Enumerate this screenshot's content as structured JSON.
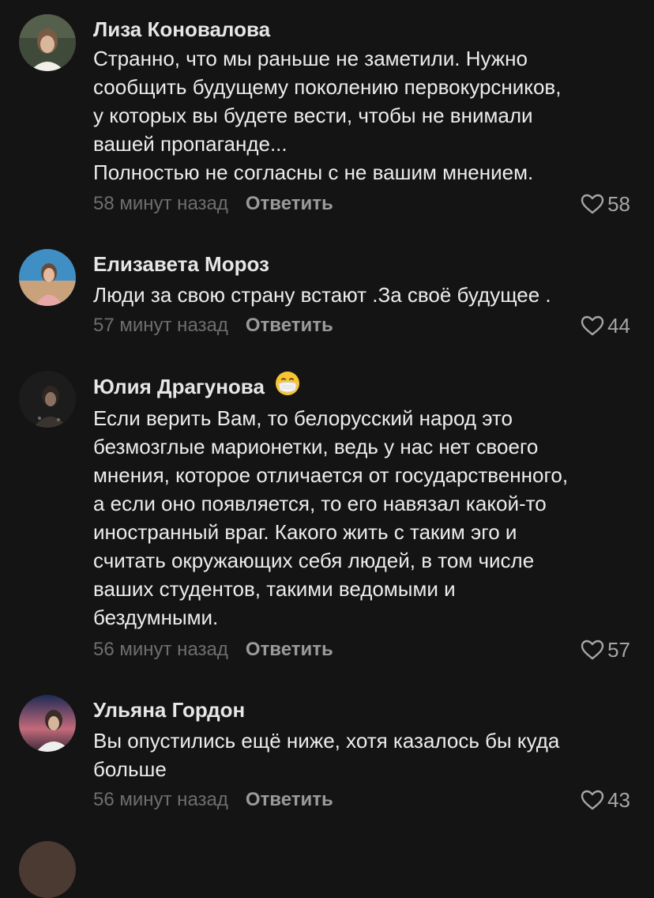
{
  "comments": [
    {
      "author": "Лиза Коновалова",
      "text": "Странно, что мы раньше не заметили. Нужно\nсообщить будущему поколению первокурсников,\nу которых вы будете вести, чтобы не внимали\nвашей пропаганде...\nПолностью не согласны с не вашим мнением.",
      "time": "58 минут назад",
      "reply_label": "Ответить",
      "likes": "58"
    },
    {
      "author": "Елизавета Мороз",
      "text": "Люди за свою страну встают .За своё будущее .",
      "time": "57 минут назад",
      "reply_label": "Ответить",
      "likes": "44"
    },
    {
      "author": "Юлия Драгунова",
      "author_emoji": "face-with-medical-mask-icon",
      "text": "Если верить Вам, то белорусский народ это\nбезмозглые марионетки, ведь у нас нет своего\nмнения, которое отличается от государственного,\nа если оно появляется, то его навязал какой-то\nиностранный враг. Какого жить с таким эго и\nсчитать окружающих себя людей, в том числе\nваших студентов, такими ведомыми и\nбездумными.",
      "time": "56 минут назад",
      "reply_label": "Ответить",
      "likes": "57"
    },
    {
      "author": "Ульяна Гордон",
      "text": "Вы опустились ещё ниже, хотя казалось бы куда\nбольше",
      "time": "56 минут назад",
      "reply_label": "Ответить",
      "likes": "43"
    }
  ],
  "colors": {
    "background": "#141414",
    "text": "#ececec",
    "meta": "#6e6e6e",
    "reply": "#9a9a9a",
    "like": "#a6a6a6"
  }
}
